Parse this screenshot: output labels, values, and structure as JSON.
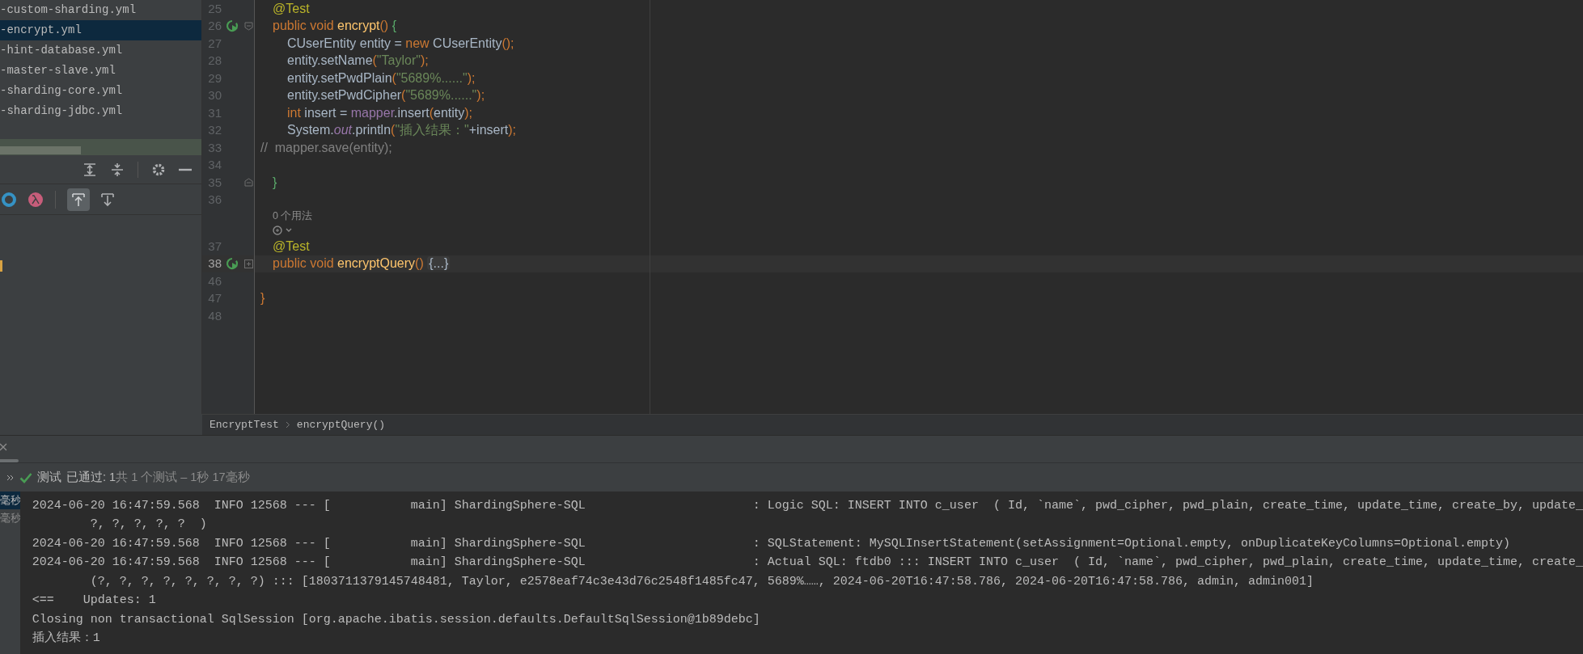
{
  "project_files": [
    {
      "name": "-custom-sharding.yml",
      "selected": false
    },
    {
      "name": "-encrypt.yml",
      "selected": true
    },
    {
      "name": "-hint-database.yml",
      "selected": false
    },
    {
      "name": "-master-slave.yml",
      "selected": false
    },
    {
      "name": "-sharding-core.yml",
      "selected": false
    },
    {
      "name": "-sharding-jdbc.yml",
      "selected": false
    }
  ],
  "editor": {
    "lines": [
      {
        "kind": "block",
        "children": [
          {
            "kind": "code",
            "num": "25",
            "tokens": [
              {
                "kind": "ann",
                "text": "@Test"
              }
            ]
          },
          {
            "kind": "code",
            "num": "26",
            "run": true,
            "fold": {
              "kind": "open"
            },
            "tokens": [
              {
                "kind": "kw",
                "text": "public void "
              },
              {
                "kind": "fn",
                "text": "encrypt"
              },
              {
                "kind": "paren",
                "text": "() "
              },
              {
                "kind": "brace",
                "text": "{"
              }
            ],
            "children": [
              {
                "kind": "code",
                "num": "27",
                "tokens": [
                  {
                    "kind": "plain",
                    "text": "CUserEntity entity = "
                  },
                  {
                    "kind": "kw",
                    "text": "new "
                  },
                  {
                    "kind": "plain",
                    "text": "CUserEntity"
                  },
                  {
                    "kind": "paren",
                    "text": "();"
                  }
                ]
              },
              {
                "kind": "code",
                "num": "28",
                "tokens": [
                  {
                    "kind": "plain",
                    "text": "entity.setName"
                  },
                  {
                    "kind": "paren",
                    "text": "("
                  },
                  {
                    "kind": "str",
                    "text": "\"Taylor\""
                  },
                  {
                    "kind": "paren",
                    "text": ");"
                  }
                ]
              },
              {
                "kind": "code",
                "num": "29",
                "tokens": [
                  {
                    "kind": "plain",
                    "text": "entity.setPwdPlain"
                  },
                  {
                    "kind": "paren",
                    "text": "("
                  },
                  {
                    "kind": "str",
                    "text": "\"5689%......\""
                  },
                  {
                    "kind": "paren",
                    "text": ");"
                  }
                ]
              },
              {
                "kind": "code",
                "num": "30",
                "tokens": [
                  {
                    "kind": "plain",
                    "text": "entity.setPwdCipher"
                  },
                  {
                    "kind": "paren",
                    "text": "("
                  },
                  {
                    "kind": "str",
                    "text": "\"5689%......\""
                  },
                  {
                    "kind": "paren",
                    "text": ");"
                  }
                ]
              },
              {
                "kind": "code",
                "num": "31",
                "tokens": [
                  {
                    "kind": "kw",
                    "text": "int "
                  },
                  {
                    "kind": "plain",
                    "text": "insert = "
                  },
                  {
                    "kind": "field",
                    "text": "mapper"
                  },
                  {
                    "kind": "plain",
                    "text": ".insert"
                  },
                  {
                    "kind": "paren",
                    "text": "("
                  },
                  {
                    "kind": "plain",
                    "text": "entity"
                  },
                  {
                    "kind": "paren",
                    "text": ");"
                  }
                ]
              },
              {
                "kind": "code",
                "num": "32",
                "tokens": [
                  {
                    "kind": "plain",
                    "text": "System."
                  },
                  {
                    "kind": "static",
                    "text": "out"
                  },
                  {
                    "kind": "plain",
                    "text": ".println"
                  },
                  {
                    "kind": "paren",
                    "text": "("
                  },
                  {
                    "kind": "str",
                    "text": "\"插入结果：\""
                  },
                  {
                    "kind": "plain",
                    "text": "+insert"
                  },
                  {
                    "kind": "paren",
                    "text": ");"
                  }
                ]
              }
            ]
          }
        ]
      },
      {
        "kind": "code",
        "num": "33",
        "tokens": [
          {
            "kind": "comment",
            "text": "//  mapper.save(entity);"
          }
        ]
      },
      {
        "kind": "code",
        "num": "34"
      },
      {
        "kind": "block",
        "children": [
          {
            "kind": "code",
            "num": "35",
            "fold": {
              "kind": "close"
            },
            "tokens": [
              {
                "kind": "brace",
                "text": "}"
              }
            ]
          },
          {
            "kind": "code",
            "num": "36"
          },
          {
            "kind": "usages",
            "text": "0 个用法"
          },
          {
            "kind": "author"
          },
          {
            "kind": "code",
            "num": "37",
            "tokens": [
              {
                "kind": "ann",
                "text": "@Test"
              }
            ]
          },
          {
            "kind": "code",
            "num": "38",
            "run": true,
            "fold": {
              "kind": "collapsed"
            },
            "current": true,
            "tokens": [
              {
                "kind": "kw",
                "text": "public void "
              },
              {
                "kind": "fn",
                "text": "encryptQuery"
              },
              {
                "kind": "paren",
                "text": "() "
              },
              {
                "kind": "folded",
                "text": "{...}"
              }
            ]
          }
        ]
      },
      {
        "kind": "code",
        "num": "46"
      },
      {
        "kind": "code",
        "num": "47",
        "tokens": [
          {
            "kind": "paren",
            "text": "}"
          }
        ]
      },
      {
        "kind": "code",
        "num": "48"
      }
    ]
  },
  "breadcrumb": [
    "EncryptTest",
    "encryptQuery()"
  ],
  "run_panel": {
    "status": {
      "label": "测试",
      "passed": "已通过: 1",
      "summary": "共 1 个测试 – 1秒 17毫秒"
    },
    "tree": [
      {
        "label": "毫秒",
        "selected": true
      },
      {
        "label": "毫秒",
        "selected": false
      }
    ],
    "console": [
      "2024-06-20 16:47:59.568  INFO 12568 --- [           main] ShardingSphere-SQL                       : Logic SQL: INSERT INTO c_user  ( Id, `name`, pwd_cipher, pwd_plain, create_time, update_time, create_by, update_",
      "        ?, ?, ?, ?, ?  )",
      "2024-06-20 16:47:59.568  INFO 12568 --- [           main] ShardingSphere-SQL                       : SQLStatement: MySQLInsertStatement(setAssignment=Optional.empty, onDuplicateKeyColumns=Optional.empty)",
      "2024-06-20 16:47:59.568  INFO 12568 --- [           main] ShardingSphere-SQL                       : Actual SQL: ftdb0 ::: INSERT INTO c_user  ( Id, `name`, pwd_cipher, pwd_plain, create_time, update_time, create_",
      "        (?, ?, ?, ?, ?, ?, ?, ?) ::: [1803711379145748481, Taylor, e2578eaf74c3e43d76c2548f1485fc47, 5689%……, 2024-06-20T16:47:58.786, 2024-06-20T16:47:58.786, admin, admin001]",
      "<==    Updates: 1",
      "Closing non transactional SqlSession [org.apache.ibatis.session.defaults.DefaultSqlSession@1b89debc]",
      "插入结果：1"
    ]
  }
}
